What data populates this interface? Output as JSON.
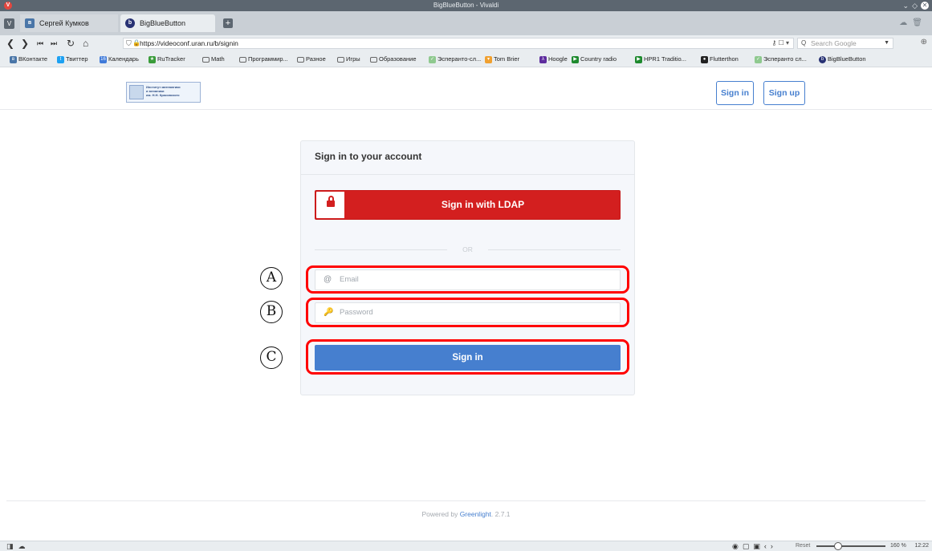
{
  "window": {
    "title": "BigBlueButton - Vivaldi"
  },
  "tabs": [
    {
      "label": "Сергей Кумков",
      "icon": "vk-icon"
    },
    {
      "label": "BigBlueButton",
      "icon": "bigbluebutton-icon"
    }
  ],
  "address": {
    "url": "https://videoconf.uran.ru/b/signin",
    "search_placeholder": "Search Google"
  },
  "bookmarks": [
    {
      "label": "ВКонтакте",
      "icon": "vk-icon",
      "color": "#4a76a8"
    },
    {
      "label": "Твиттер",
      "icon": "twitter-icon",
      "color": "#1da1f2"
    },
    {
      "label": "Календарь",
      "icon": "calendar-icon",
      "color": "#3f7ad9"
    },
    {
      "label": "RuTracker",
      "icon": "rutracker-icon",
      "color": "#3a9c3a"
    },
    {
      "label": "Math",
      "icon": "folder-icon"
    },
    {
      "label": "Программир...",
      "icon": "folder-icon"
    },
    {
      "label": "Разное",
      "icon": "folder-icon"
    },
    {
      "label": "Игры",
      "icon": "folder-icon"
    },
    {
      "label": "Образование",
      "icon": "folder-icon"
    },
    {
      "label": "Эсперанто-сл...",
      "icon": "esperanto-icon",
      "color": "#8fc98f"
    },
    {
      "label": "Tom Brier",
      "icon": "tombrier-icon",
      "color": "#f0a030"
    },
    {
      "label": "Hoogle",
      "icon": "lambda-icon",
      "color": "#5e2d9e"
    },
    {
      "label": "Country radio",
      "icon": "radio-icon",
      "color": "#1e8a2e"
    },
    {
      "label": "HPR1 Traditio...",
      "icon": "radio-icon",
      "color": "#1e8a2e"
    },
    {
      "label": "Flutterthon",
      "icon": "github-icon",
      "color": "#222222"
    },
    {
      "label": "Эсперанто сл...",
      "icon": "esperanto-icon",
      "color": "#8fc98f"
    },
    {
      "label": "BigBlueButton",
      "icon": "bigbluebutton-icon",
      "color": "#283274"
    }
  ],
  "header": {
    "logo_text": "Институт математики\nи механики\nим. Н.Н. Красовского",
    "signin_label": "Sign in",
    "signup_label": "Sign up"
  },
  "card": {
    "title": "Sign in to your account",
    "ldap_label": "Sign in with LDAP",
    "or_text": "OR",
    "email_placeholder": "Email",
    "password_placeholder": "Password",
    "signin_label": "Sign in"
  },
  "annotations": {
    "a": "A",
    "b": "B",
    "c": "C"
  },
  "footer": {
    "prefix": "Powered by ",
    "link": "Greenlight",
    "version": ". 2.7.1"
  },
  "statusbar": {
    "zoom_reset": "Reset",
    "zoom_level": "160 %",
    "zoom_fraction": 0.3,
    "clock": "12:22"
  },
  "colors": {
    "accent": "#467fcf",
    "ldap_red": "#d31f1f",
    "highlight": "#ff0000"
  }
}
